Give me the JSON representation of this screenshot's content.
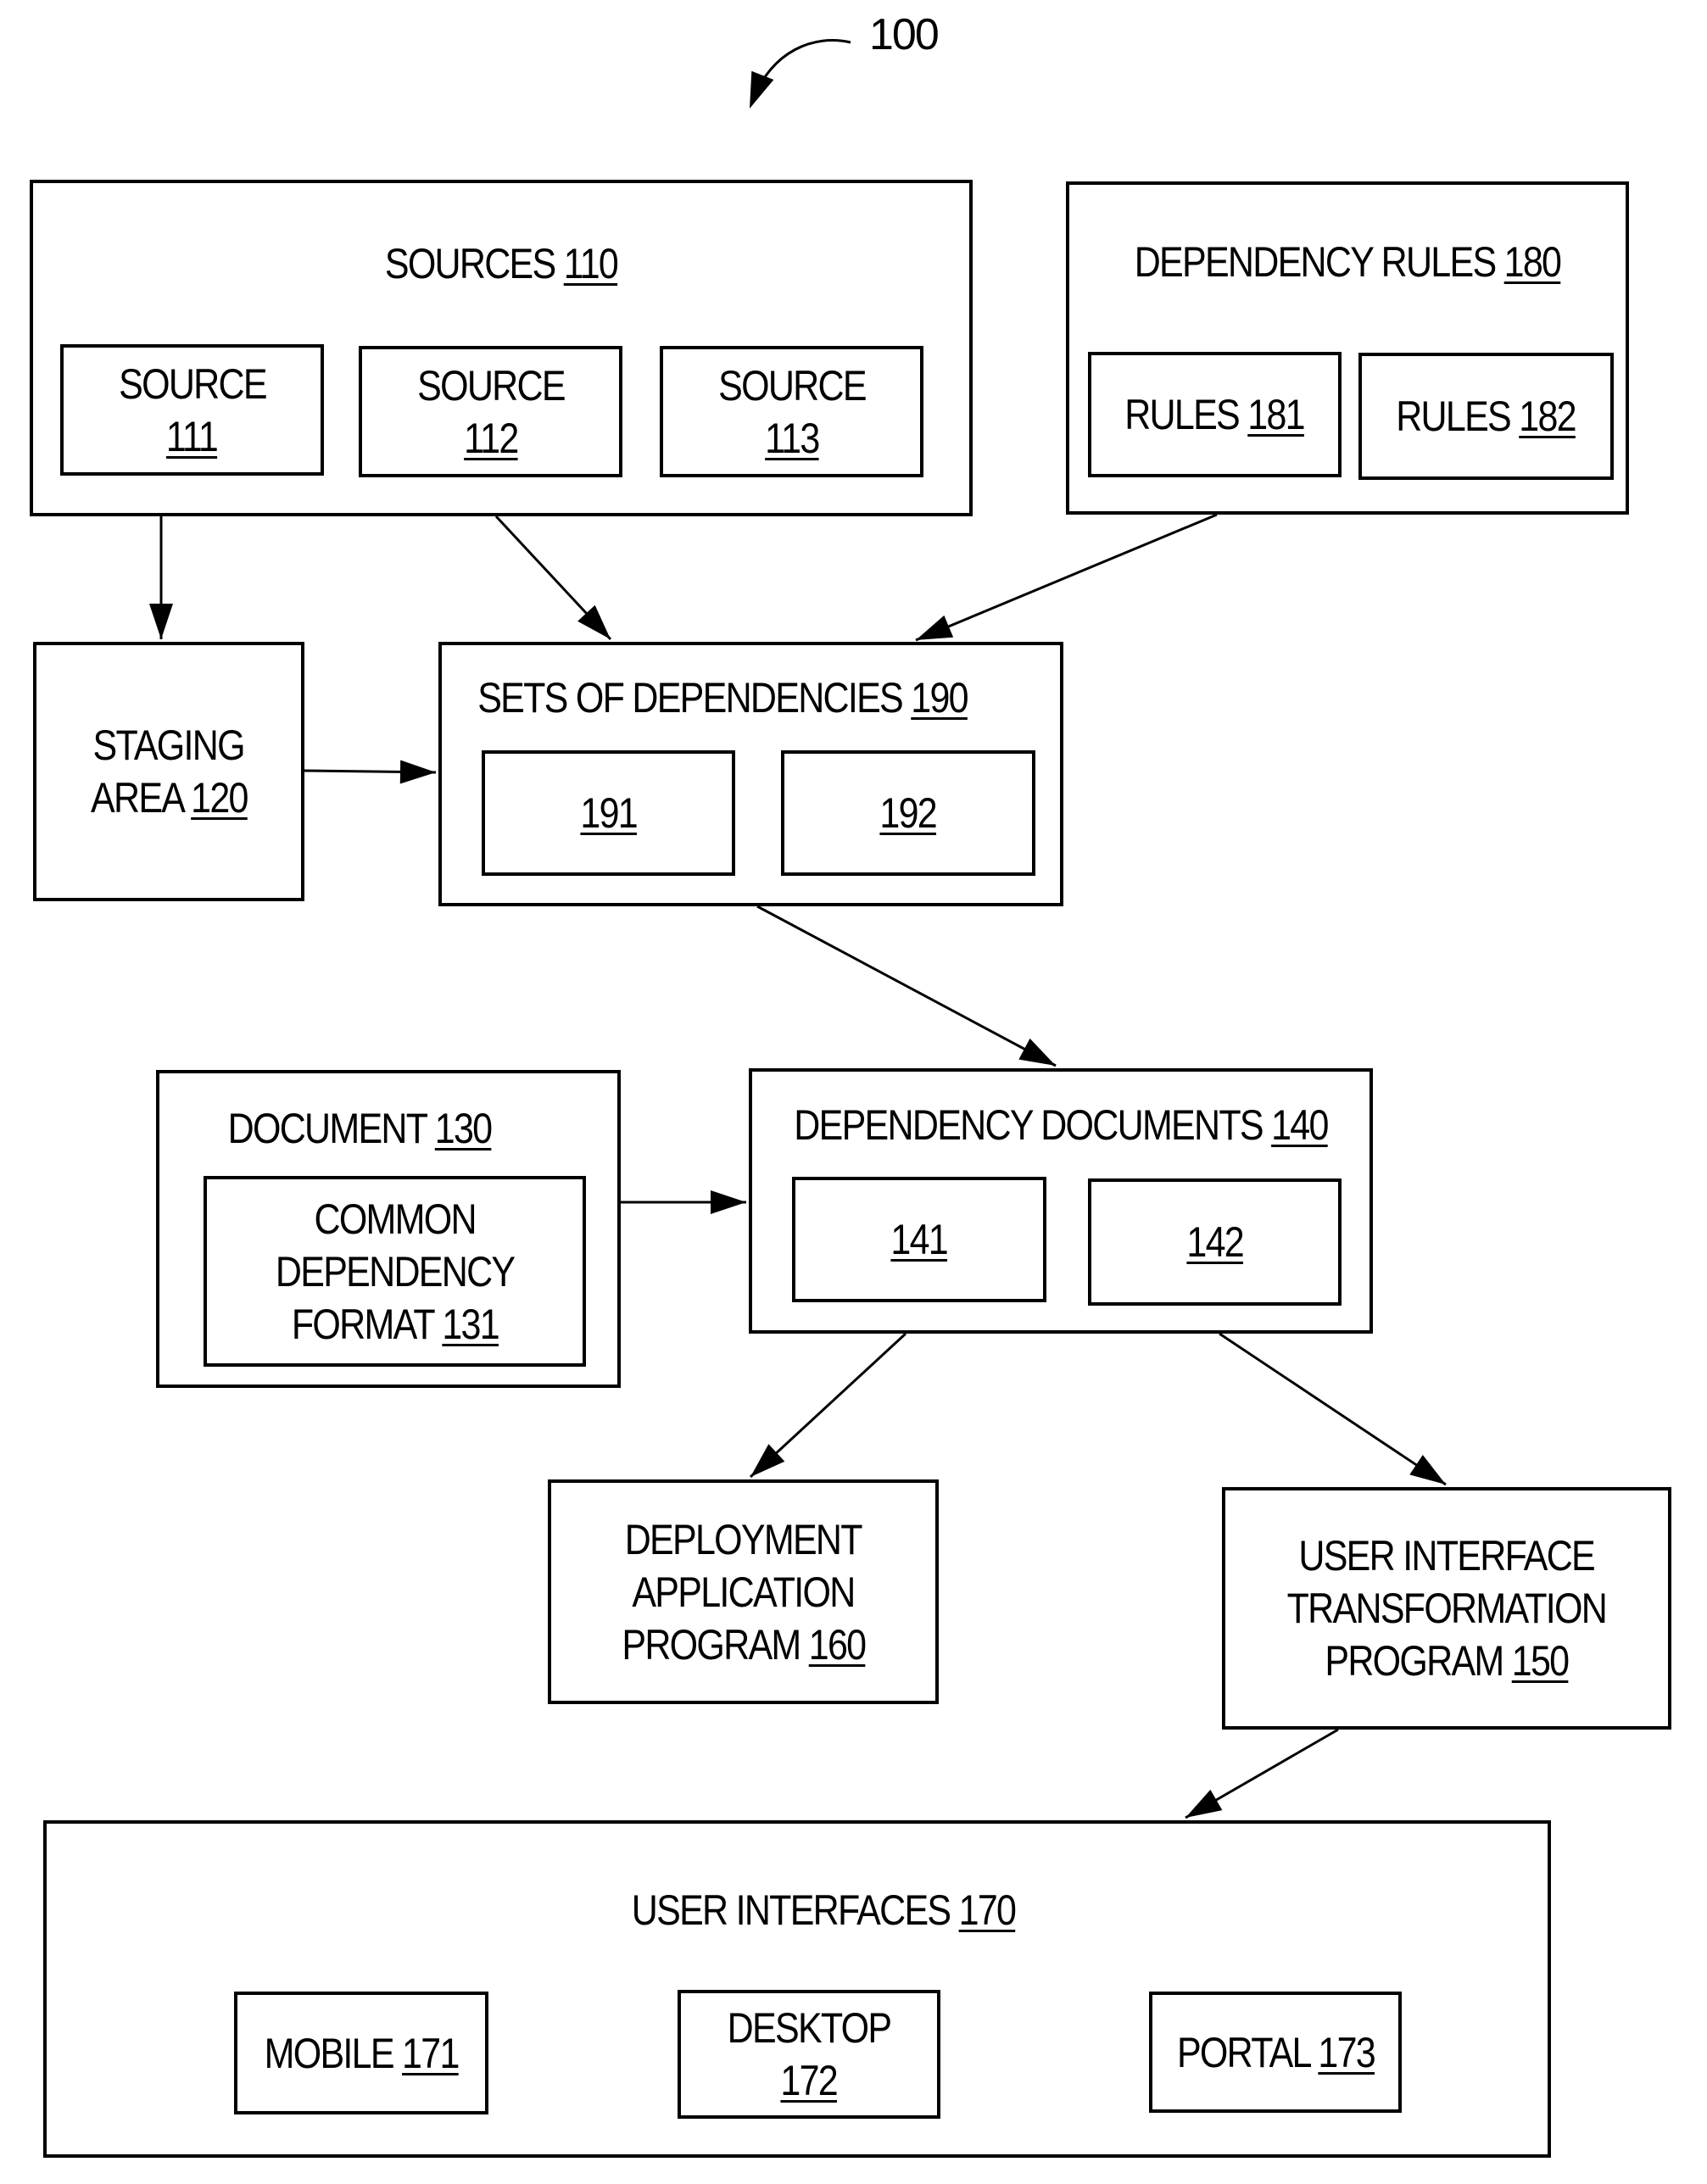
{
  "figure_ref": "100",
  "nodes": {
    "sources": {
      "name": "SOURCES",
      "ref": "110"
    },
    "source111": {
      "line1": "SOURCE",
      "ref": "111"
    },
    "source112": {
      "line1": "SOURCE",
      "ref": "112"
    },
    "source113": {
      "line1": "SOURCE",
      "ref": "113"
    },
    "dependency_rules": {
      "name": "DEPENDENCY RULES",
      "ref": "180"
    },
    "rules181": {
      "name": "RULES",
      "ref": "181"
    },
    "rules182": {
      "name": "RULES",
      "ref": "182"
    },
    "staging": {
      "line1": "STAGING",
      "line2": "AREA",
      "ref": "120"
    },
    "sets_of_dependencies": {
      "name": "SETS OF DEPENDENCIES",
      "ref": "190"
    },
    "set191": {
      "ref": "191"
    },
    "set192": {
      "ref": "192"
    },
    "document": {
      "name": "DOCUMENT",
      "ref": "130"
    },
    "common_format": {
      "line1": "COMMON",
      "line2": "DEPENDENCY",
      "line3": "FORMAT",
      "ref": "131"
    },
    "dependency_documents": {
      "name": "DEPENDENCY DOCUMENTS",
      "ref": "140"
    },
    "doc141": {
      "ref": "141"
    },
    "doc142": {
      "ref": "142"
    },
    "deployment": {
      "line1": "DEPLOYMENT",
      "line2": "APPLICATION",
      "line3": "PROGRAM",
      "ref": "160"
    },
    "ui_transformation": {
      "line1": "USER INTERFACE",
      "line2": "TRANSFORMATION",
      "line3": "PROGRAM",
      "ref": "150"
    },
    "user_interfaces": {
      "name": "USER INTERFACES",
      "ref": "170"
    },
    "mobile": {
      "name": "MOBILE",
      "ref": "171"
    },
    "desktop": {
      "line1": "DESKTOP",
      "ref": "172"
    },
    "portal": {
      "name": "PORTAL",
      "ref": "173"
    }
  },
  "edges": [
    {
      "from": "110",
      "to": "120"
    },
    {
      "from": "110",
      "to": "190"
    },
    {
      "from": "180",
      "to": "190"
    },
    {
      "from": "120",
      "to": "190"
    },
    {
      "from": "190",
      "to": "140"
    },
    {
      "from": "130",
      "to": "140"
    },
    {
      "from": "140",
      "to": "160"
    },
    {
      "from": "140",
      "to": "150"
    },
    {
      "from": "150",
      "to": "170"
    }
  ]
}
